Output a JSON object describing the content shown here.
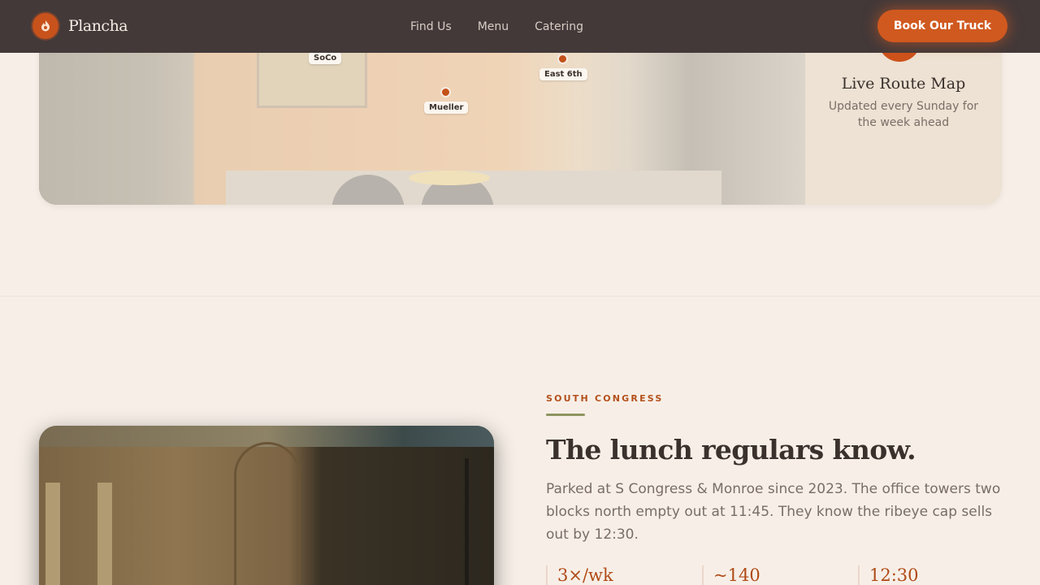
{
  "nav": {
    "brand": "Plancha",
    "links": [
      "Find Us",
      "Menu",
      "Catering"
    ],
    "cta": "Book Our Truck"
  },
  "map": {
    "title": "Live Route Map",
    "subtitle": "Updated every Sunday for the week ahead",
    "pins": [
      "SoCo",
      "Mueller",
      "East 6th"
    ]
  },
  "feature": {
    "eyebrow": "SOUTH CONGRESS",
    "headline": "The lunch regulars know.",
    "body": "Parked at S Congress & Monroe since 2023. The office towers two blocks north empty out at 11:45. They know the ribeye cap sells out by 12:30.",
    "stats": [
      "3×/wk",
      "~140",
      "12:30"
    ]
  },
  "colors": {
    "accent": "#d0591f",
    "nav_bg": "#433939",
    "page_bg": "#f7efe7",
    "eyebrow_rule": "#8e9460"
  }
}
